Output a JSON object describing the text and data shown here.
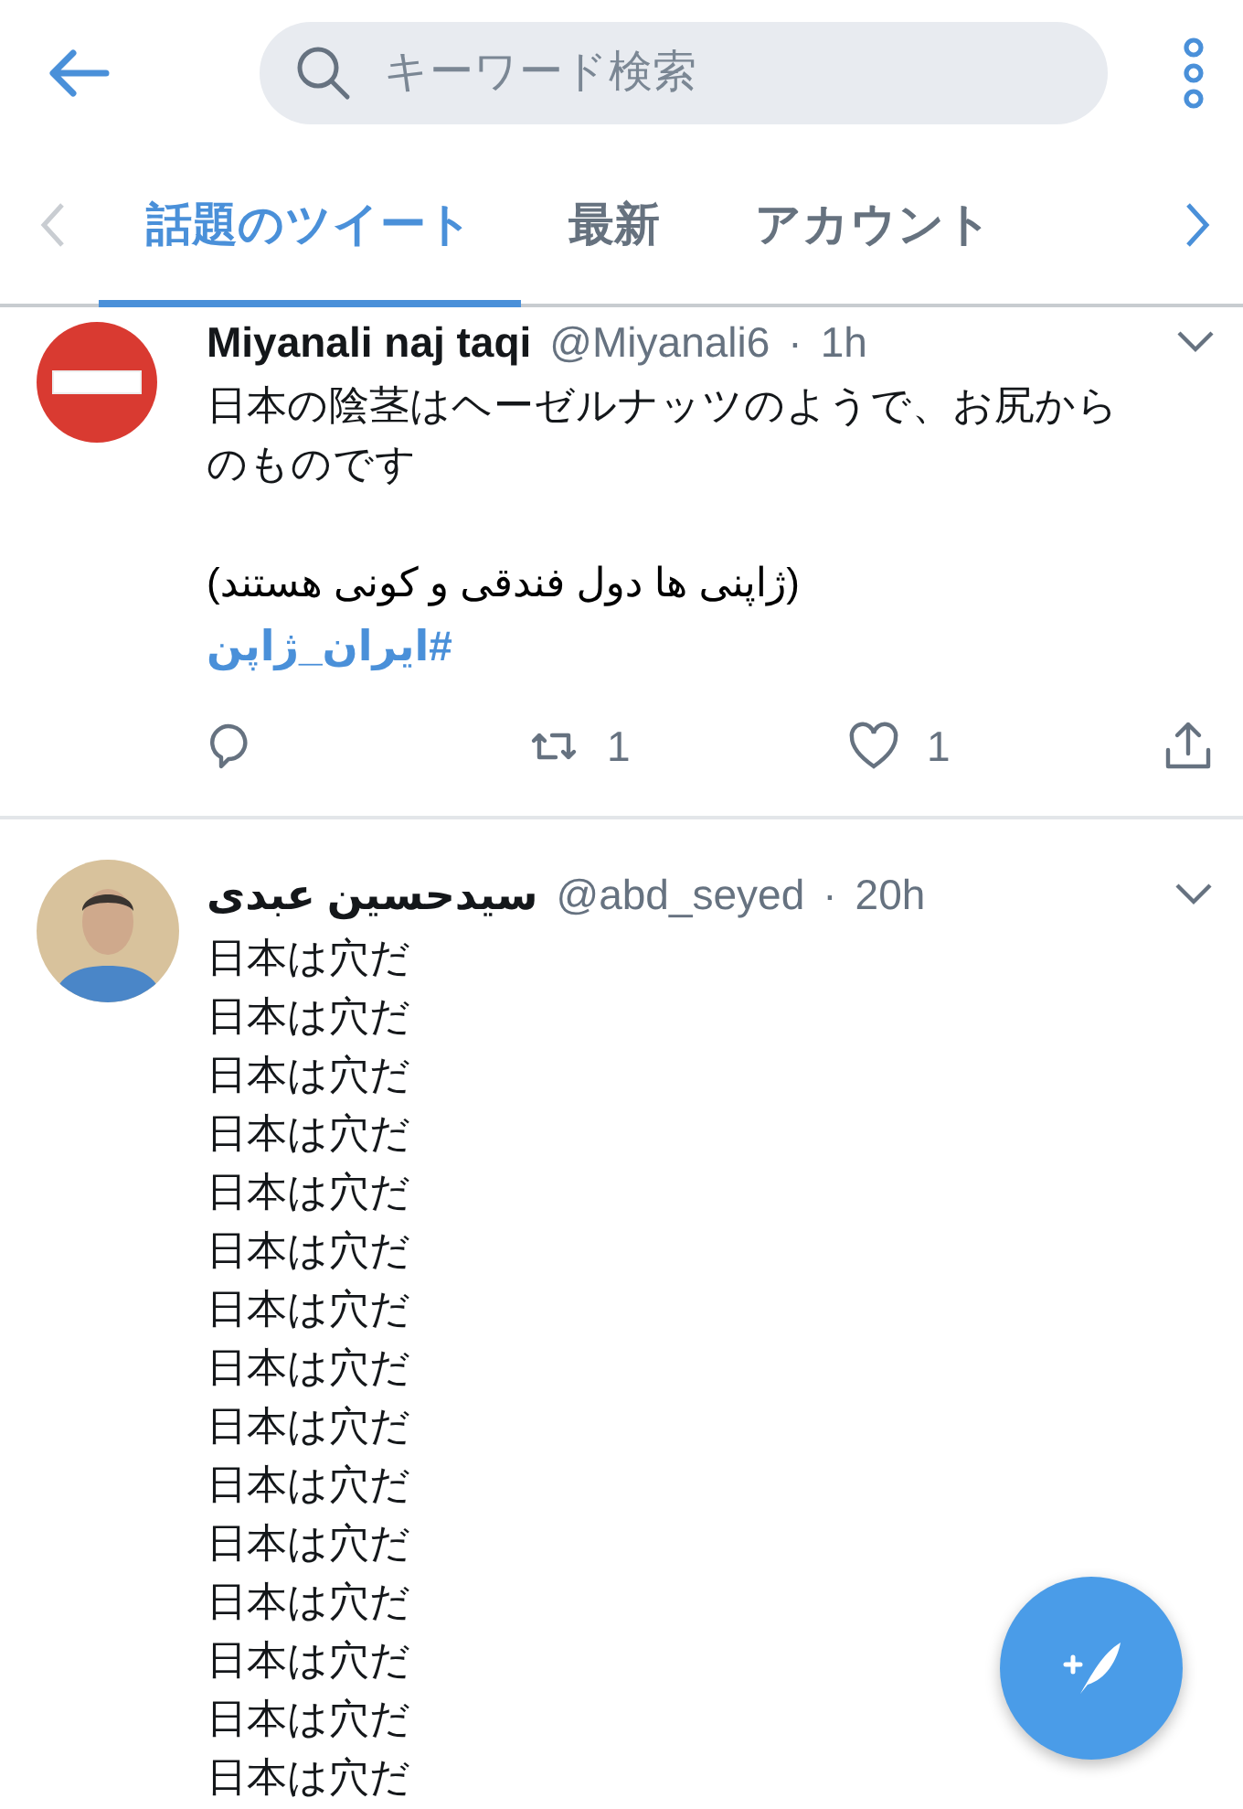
{
  "search": {
    "placeholder": "キーワード検索"
  },
  "tabs": [
    {
      "label": "話題のツイート",
      "selected": true
    },
    {
      "label": "最新",
      "selected": false
    },
    {
      "label": "アカウント",
      "selected": false
    }
  ],
  "tweets": [
    {
      "name": "Miyanali naj taqi",
      "handle": "@Miyanali6",
      "separator": "·",
      "time": "1h",
      "kind": "no-entry",
      "text": "日本の陰茎はヘーゼルナッツのようで、お尻からのものです",
      "persian": "(ژاپنی ها دول فندقی و کونی هستند)",
      "hashtag": "#ایران_ژاپن",
      "retweets": "1",
      "likes": "1"
    },
    {
      "name": "سیدحسین عبدی",
      "handle": "@abd_seyed",
      "separator": "·",
      "time": "20h",
      "lines": [
        "日本は穴だ",
        "日本は穴だ",
        "日本は穴だ",
        "日本は穴だ",
        "日本は穴だ",
        "日本は穴だ",
        "日本は穴だ",
        "日本は穴だ",
        "日本は穴だ",
        "日本は穴だ",
        "日本は穴だ",
        "日本は穴だ",
        "日本は穴だ",
        "日本は穴だ",
        "日本は穴だ"
      ]
    }
  ]
}
